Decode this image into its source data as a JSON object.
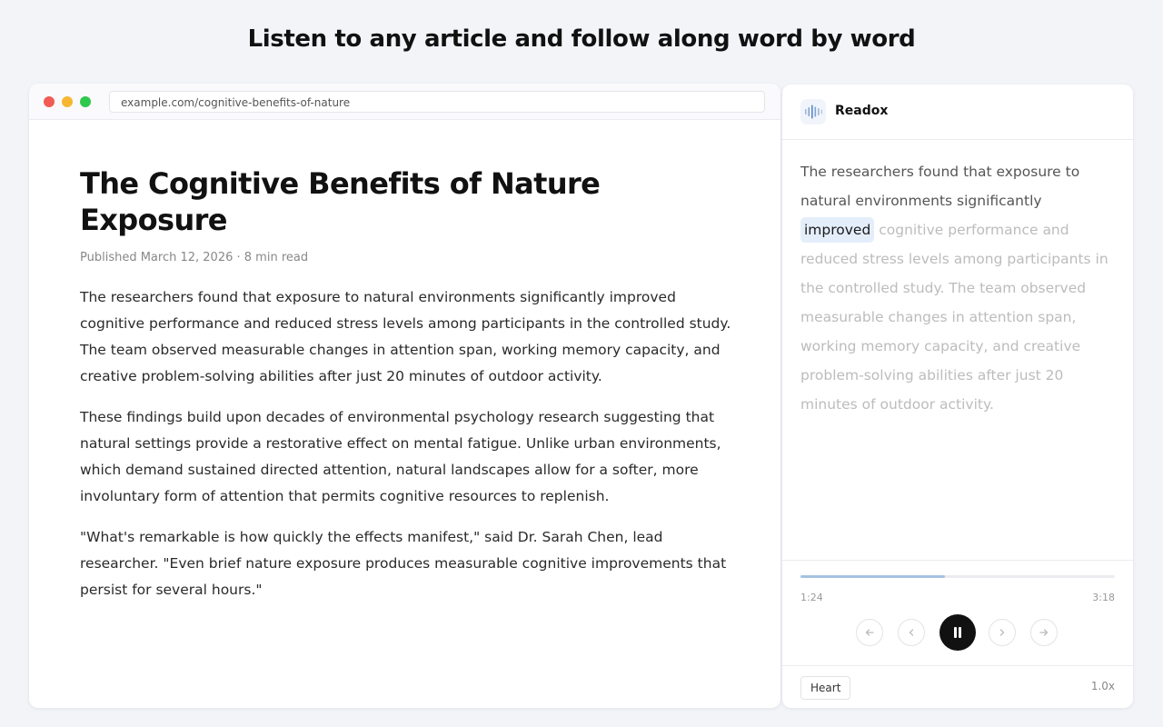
{
  "headline": "Listen to any article and follow along word by word",
  "browser": {
    "url": "example.com/cognitive-benefits-of-nature"
  },
  "article": {
    "title": "The Cognitive Benefits of Nature Exposure",
    "meta": "Published March 12, 2026 · 8 min read",
    "paragraphs": [
      "The researchers found that exposure to natural environments significantly improved cognitive performance and reduced stress levels among participants in the controlled study. The team observed measurable changes in attention span, working memory capacity, and creative problem-solving abilities after just 20 minutes of outdoor activity.",
      "These findings build upon decades of environmental psychology research suggesting that natural settings provide a restorative effect on mental fatigue. Unlike urban environments, which demand sustained directed attention, natural landscapes allow for a softer, more involuntary form of attention that permits cognitive resources to replenish.",
      "\"What's remarkable is how quickly the effects manifest,\" said Dr. Sarah Chen, lead researcher. \"Even brief nature exposure produces measurable cognitive improvements that persist for several hours.\""
    ]
  },
  "panel": {
    "brand": "Readox",
    "logo_icon": "audio-waveform-icon",
    "reader": {
      "read_text": "The researchers found that exposure to natural environments significantly",
      "current_word": "improved",
      "upcoming_text": "cognitive performance and reduced stress levels among participants in the controlled study. The team observed measurable changes in attention span, working memory capacity, and creative problem-solving abilities after just 20 minutes of outdoor activity."
    },
    "player": {
      "current_time": "1:24",
      "total_time": "3:18",
      "progress": 0.46,
      "controls": [
        "skip-back-icon",
        "previous-icon",
        "pause-icon",
        "next-icon",
        "skip-forward-icon"
      ]
    },
    "voice": "Heart",
    "speed": "1.0x"
  },
  "colors": {
    "highlight": "#e4eefb",
    "progress": "#a6c2e1",
    "play_button": "#111111"
  }
}
